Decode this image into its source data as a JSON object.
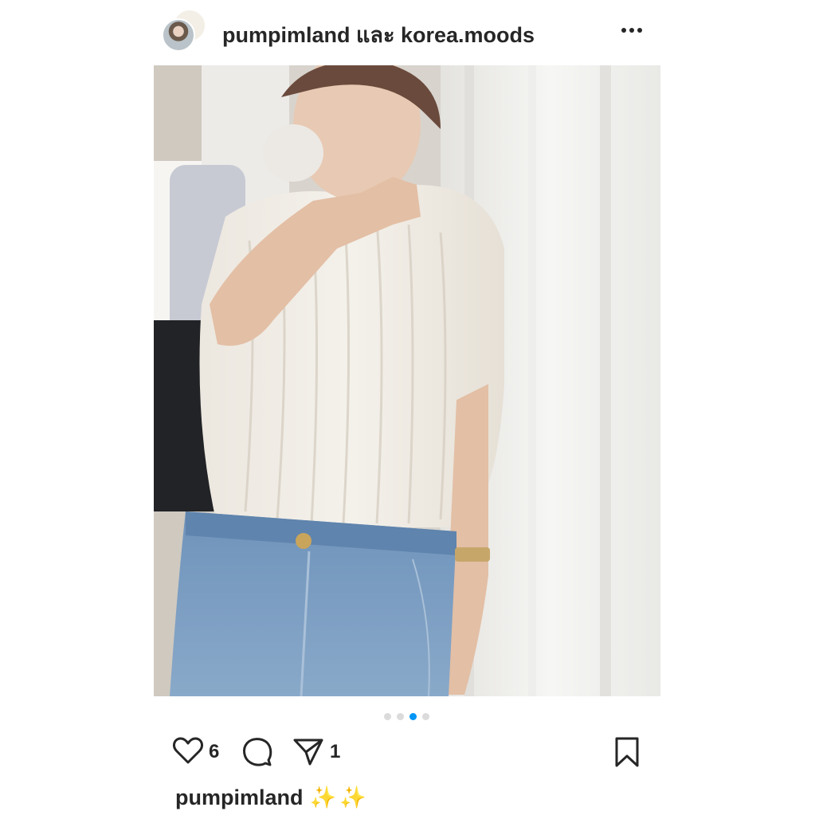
{
  "post": {
    "title": "pumpimland และ korea.moods",
    "likes": "6",
    "shares": "1",
    "carousel": {
      "total": 4,
      "active": 2
    }
  },
  "caption": {
    "username": "pumpimland",
    "emoji": "✨✨"
  },
  "icons": {
    "more": "more-options-icon",
    "like": "heart-icon",
    "comment": "comment-icon",
    "share": "send-icon",
    "save": "bookmark-icon"
  },
  "colors": {
    "text": "#262626",
    "active_dot": "#0095f6",
    "inactive_dot": "#dbdbdb"
  }
}
